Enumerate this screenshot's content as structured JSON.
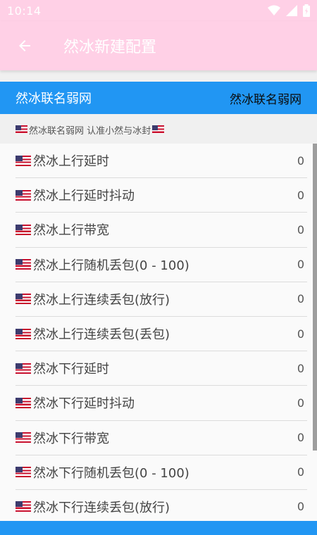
{
  "status": {
    "time": "10:14"
  },
  "app_bar": {
    "title": "然冰新建配置"
  },
  "header": {
    "left": "然冰联名弱网",
    "right": "然冰联名弱网"
  },
  "subheader": {
    "text": "然冰联名弱网 认准小然与冰封"
  },
  "items": [
    {
      "label": "然冰上行延时",
      "value": "0"
    },
    {
      "label": "然冰上行延时抖动",
      "value": "0"
    },
    {
      "label": "然冰上行带宽",
      "value": "0"
    },
    {
      "label": "然冰上行随机丢包(0 - 100)",
      "value": "0"
    },
    {
      "label": "然冰上行连续丢包(放行)",
      "value": "0"
    },
    {
      "label": "然冰上行连续丢包(丢包)",
      "value": "0"
    },
    {
      "label": "然冰下行延时",
      "value": "0"
    },
    {
      "label": "然冰下行延时抖动",
      "value": "0"
    },
    {
      "label": "然冰下行带宽",
      "value": "0"
    },
    {
      "label": "然冰下行随机丢包(0 - 100)",
      "value": "0"
    },
    {
      "label": "然冰下行连续丢包(放行)",
      "value": "0"
    }
  ],
  "icons": {
    "back": "arrow-left-icon",
    "wifi": "wifi-icon",
    "signal": "cell-signal-icon",
    "battery": "battery-charging-icon",
    "flag": "us-flag-icon"
  },
  "colors": {
    "app_bar": "#ffd0e6",
    "accent": "#2196f3"
  }
}
